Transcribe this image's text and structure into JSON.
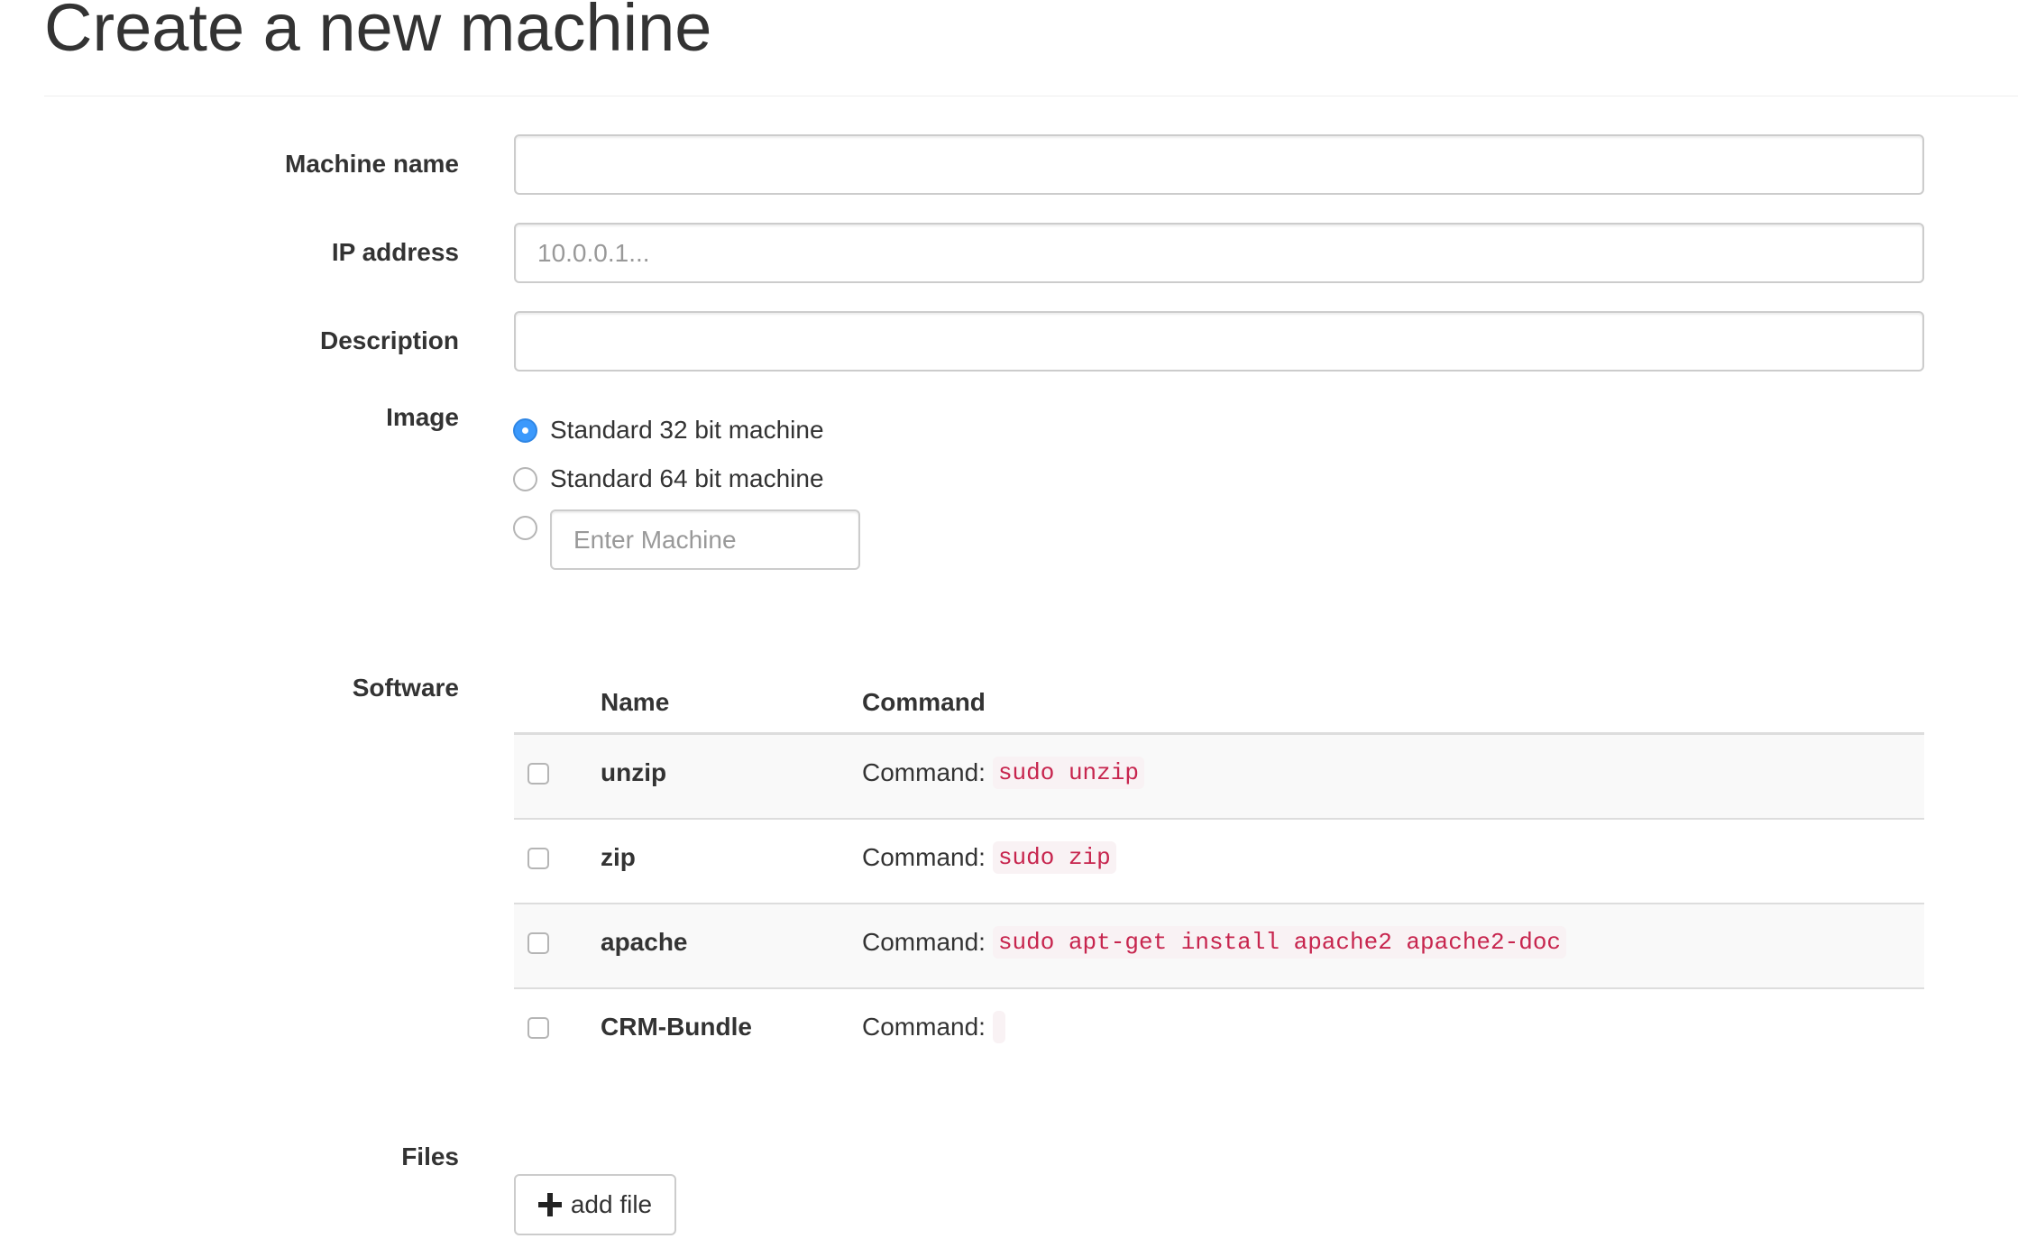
{
  "page": {
    "title": "Create a new machine"
  },
  "form": {
    "machine_name": {
      "label": "Machine name",
      "value": "",
      "placeholder": ""
    },
    "ip_address": {
      "label": "IP address",
      "value": "",
      "placeholder": "10.0.0.1..."
    },
    "description": {
      "label": "Description",
      "value": "",
      "placeholder": ""
    },
    "image": {
      "label": "Image",
      "selected": "Standard 32 bit machine",
      "options": [
        {
          "label": "Standard 32 bit machine",
          "checked": true
        },
        {
          "label": "Standard 64 bit machine",
          "checked": false
        }
      ],
      "custom": {
        "checked": false,
        "value": "",
        "placeholder": "Enter Machine"
      }
    },
    "software": {
      "label": "Software",
      "columns": [
        "",
        "Name",
        "Command"
      ],
      "command_prefix": "Command:",
      "rows": [
        {
          "checked": false,
          "name": "unzip",
          "command": "sudo unzip"
        },
        {
          "checked": false,
          "name": "zip",
          "command": "sudo zip"
        },
        {
          "checked": false,
          "name": "apache",
          "command": "sudo apt-get install apache2 apache2-doc"
        },
        {
          "checked": false,
          "name": "CRM-Bundle",
          "command": ""
        }
      ]
    },
    "files": {
      "label": "Files",
      "add_button_label": "add file",
      "add_button_icon": "plus-icon"
    }
  },
  "colors": {
    "radio_selected": "#3b99fc",
    "code_text": "#c7254e",
    "code_background": "#f9f2f4",
    "table_stripe": "#f9f9f9"
  }
}
